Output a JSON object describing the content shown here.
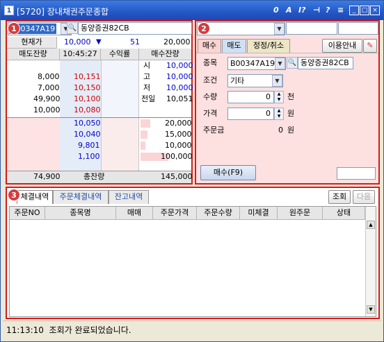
{
  "window": {
    "id_label": "[5720]",
    "title": "장내채권주문종합",
    "icon_text": "1"
  },
  "toolbar": {
    "i1": "0",
    "i2": "A",
    "i3": "I?",
    "i4": "?"
  },
  "panel1": {
    "badge": "1",
    "code": "B00347A19",
    "name": "동양증권82CB",
    "price_label": "현재가",
    "price": "10,000",
    "change_arrow": "▼",
    "change": "51",
    "volume": "20,000",
    "headers": {
      "sell": "매도잔량",
      "time": "10:45:27",
      "yield": "수익률",
      "buy": "매수잔량"
    },
    "sell_qty": [
      "8,000",
      "7,000",
      "49,900",
      "10,000"
    ],
    "sell_price": [
      "10,151",
      "10,150",
      "10,100",
      "10,080"
    ],
    "info_label": [
      "시",
      "고",
      "저",
      "전일"
    ],
    "info_val": [
      "10,000",
      "10,000",
      "10,000",
      "10,051"
    ],
    "buy_price": [
      "10,050",
      "10,040",
      "9,801",
      "1,100"
    ],
    "buy_qty": [
      "20,000",
      "15,000",
      "10,000",
      "100,000"
    ],
    "total_sell": "74,900",
    "total_label": "총잔량",
    "total_buy": "145,000"
  },
  "panel2": {
    "badge": "2",
    "tabs": [
      "매수",
      "매도",
      "정정/취소"
    ],
    "guide": "이용안내",
    "code_label": "종목",
    "code": "B00347A19",
    "name": "동양증권82CB",
    "cond_label": "조건",
    "cond": "기타",
    "qty_label": "수량",
    "qty": "0",
    "qty_unit": "천",
    "price_label": "가격",
    "price": "0",
    "price_unit": "원",
    "amt_label": "주문금",
    "amt": "0",
    "amt_unit": "원",
    "buy_btn": "매수(F9)"
  },
  "panel3": {
    "badge": "3",
    "tabs": [
      "체결내역",
      "주문체결내역",
      "잔고내역"
    ],
    "query": "조회",
    "next": "다음",
    "cols": [
      "주문NO",
      "종목명",
      "매매",
      "주문가격",
      "주문수량",
      "미체결",
      "원주문",
      "상태"
    ]
  },
  "status": {
    "time": "11:13:10",
    "msg": "조회가 완료되었습니다."
  }
}
